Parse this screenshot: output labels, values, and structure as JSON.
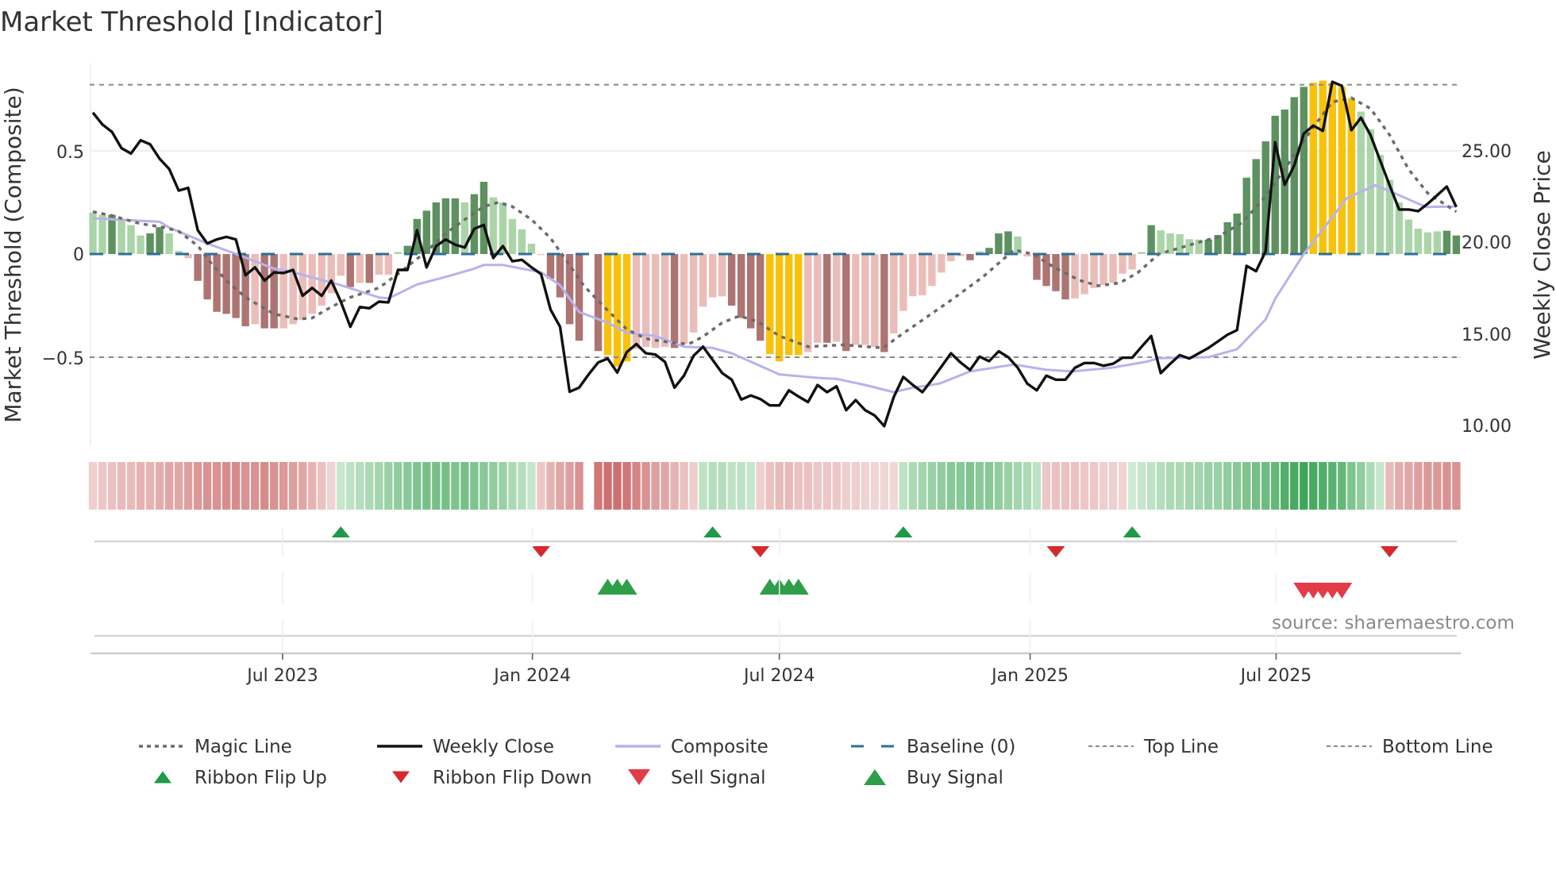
{
  "title": "Market Threshold [Indicator]",
  "source": "source: sharemaestro.com",
  "colors": {
    "G": "#5e9160",
    "g": "#abd5a8",
    "R": "#ad7472",
    "r": "#ebbdb8",
    "Y": "#f9c20a",
    "close": "#111111",
    "composite": "#b9b2ea",
    "magic": "#6b6b6b",
    "baseline": "#2e6e96",
    "threshold": "#8a8a8a",
    "flip_up": "#1f9a47",
    "flip_down": "#d62a2a",
    "buy": "#2e9e48",
    "sell": "#e23c48",
    "ribbon_up": "#2e9e4a",
    "ribbon_down": "#c85c5c"
  },
  "chart_data": {
    "type": "bar+line",
    "title": "Market Threshold [Indicator]",
    "ylabel_left": "Market Threshold (Composite)",
    "ylabel_right": "Weekly Close Price",
    "ylim_left": [
      -0.9,
      0.95
    ],
    "ylim_right": [
      8,
      31
    ],
    "y_ticks_left": [
      {
        "value": 0.5,
        "label": "0.5"
      },
      {
        "value": 0,
        "label": "0"
      },
      {
        "value": -0.5,
        "label": "−0.5"
      }
    ],
    "y_ticks_right": [
      {
        "value": 25,
        "label": "25.00"
      },
      {
        "value": 20,
        "label": "20.00"
      },
      {
        "value": 15,
        "label": "15.00"
      },
      {
        "value": 10,
        "label": "10.00"
      }
    ],
    "x_unit": "week index",
    "x_ticks": [
      {
        "week": 19.9,
        "label": "Jul 2023"
      },
      {
        "week": 46.1,
        "label": "Jan 2024"
      },
      {
        "week": 72.0,
        "label": "Jul 2024"
      },
      {
        "week": 98.3,
        "label": "Jan 2025"
      },
      {
        "week": 124.1,
        "label": "Jul 2025"
      }
    ],
    "top_line": 0.82,
    "bottom_line": -0.5,
    "baseline": 0,
    "histogram": [
      0.2,
      0.19,
      0.19,
      0.17,
      0.14,
      0.09,
      0.1,
      0.13,
      0.1,
      0.015,
      -0.02,
      -0.13,
      -0.22,
      -0.28,
      -0.29,
      -0.31,
      -0.35,
      -0.34,
      -0.36,
      -0.36,
      -0.36,
      -0.34,
      -0.32,
      -0.29,
      -0.25,
      -0.19,
      -0.105,
      -0.16,
      -0.14,
      -0.14,
      -0.1,
      -0.1,
      0.01,
      0.04,
      0.17,
      0.21,
      0.25,
      0.27,
      0.27,
      0.25,
      0.29,
      0.35,
      0.275,
      0.25,
      0.17,
      0.12,
      0.05,
      -0.005,
      -0.12,
      -0.21,
      -0.34,
      -0.42,
      null,
      -0.47,
      -0.49,
      -0.545,
      -0.52,
      -0.46,
      -0.45,
      -0.455,
      -0.45,
      -0.455,
      -0.435,
      -0.38,
      -0.255,
      -0.21,
      -0.205,
      -0.25,
      -0.31,
      -0.36,
      -0.42,
      -0.485,
      -0.52,
      -0.49,
      -0.49,
      -0.475,
      -0.43,
      -0.43,
      -0.425,
      -0.47,
      -0.44,
      -0.44,
      -0.45,
      -0.475,
      -0.385,
      -0.275,
      -0.205,
      -0.2,
      -0.155,
      -0.09,
      -0.035,
      -0.01,
      -0.03,
      0.013,
      0.03,
      0.1,
      0.11,
      0.085,
      -0.012,
      -0.125,
      -0.155,
      -0.18,
      -0.22,
      -0.215,
      -0.195,
      -0.165,
      -0.15,
      -0.14,
      -0.095,
      -0.075,
      0.01,
      0.14,
      0.115,
      0.1,
      0.096,
      0.072,
      0.07,
      0.07,
      0.092,
      0.154,
      0.196,
      0.37,
      0.46,
      0.546,
      0.67,
      0.7,
      0.76,
      0.81,
      0.83,
      0.84,
      0.83,
      0.81,
      0.755,
      0.69,
      0.605,
      0.48,
      0.36,
      0.25,
      0.167,
      0.123,
      0.105,
      0.11,
      0.113,
      0.09
    ],
    "histogram_states": "ggGgggGGggrRRRRRRrRRrrrrrrrRrRrrgGGGGGGgGGgggggrRRRR-RYYYrrrrRrrrrrRRRRYYYYrrRrRrrrRrrrrrrrrRgGGGgrRRRRrrrrrrrgGgggggGGGGGGGGGGGYYYYYgggggggggGGg",
    "weekly_close": [
      27.1,
      26.45,
      26.05,
      25.16,
      24.87,
      25.59,
      25.37,
      24.58,
      24.03,
      22.85,
      23.0,
      20.69,
      19.97,
      20.19,
      20.33,
      20.19,
      18.24,
      18.67,
      17.95,
      18.39,
      18.36,
      18.53,
      17.12,
      17.55,
      17.12,
      17.95,
      16.8,
      15.43,
      16.51,
      16.44,
      16.8,
      16.76,
      18.53,
      18.53,
      20.69,
      18.67,
      19.83,
      20.19,
      19.9,
      19.75,
      20.77,
      20.98,
      19.18,
      19.83,
      19.0,
      19.08,
      18.67,
      18.31,
      16.37,
      15.43,
      11.9,
      12.12,
      12.84,
      13.49,
      13.7,
      12.94,
      14.06,
      14.49,
      13.99,
      13.92,
      13.52,
      12.12,
      12.77,
      13.85,
      14.35,
      13.63,
      12.91,
      12.55,
      11.47,
      11.69,
      11.5,
      11.15,
      11.15,
      11.97,
      11.64,
      11.33,
      12.26,
      11.87,
      12.19,
      10.89,
      11.44,
      10.89,
      10.6,
      10.02,
      11.61,
      12.7,
      12.26,
      11.87,
      12.55,
      13.27,
      13.99,
      13.49,
      13.08,
      13.81,
      13.56,
      14.1,
      13.78,
      13.2,
      12.34,
      11.97,
      12.77,
      12.55,
      12.55,
      13.2,
      13.46,
      13.46,
      13.31,
      13.42,
      13.75,
      13.75,
      14.35,
      14.93,
      12.91,
      13.42,
      13.89,
      13.7,
      13.99,
      14.28,
      14.64,
      15.0,
      15.25,
      18.75,
      18.46,
      19.54,
      25.48,
      23.17,
      24.22,
      25.95,
      26.39,
      26.1,
      28.77,
      28.55,
      26.14,
      26.82,
      25.88,
      24.51,
      23.14,
      21.82,
      21.82,
      21.73,
      22.13,
      22.6,
      23.07,
      21.96
    ],
    "composite": [
      [
        0,
        21.34
      ],
      [
        7,
        21.15
      ],
      [
        8,
        20.84
      ],
      [
        12,
        19.97
      ],
      [
        15,
        19.4
      ],
      [
        19,
        18.6
      ],
      [
        21,
        18.4
      ],
      [
        26,
        17.7
      ],
      [
        30,
        17.03
      ],
      [
        31,
        16.98
      ],
      [
        34,
        17.74
      ],
      [
        37,
        18.15
      ],
      [
        40,
        18.6
      ],
      [
        41,
        18.8
      ],
      [
        43,
        18.8
      ],
      [
        47,
        18.4
      ],
      [
        49,
        17.7
      ],
      [
        51,
        16.24
      ],
      [
        54,
        15.66
      ],
      [
        56,
        15.1
      ],
      [
        59,
        14.93
      ],
      [
        62,
        14.35
      ],
      [
        65,
        14.28
      ],
      [
        67,
        13.99
      ],
      [
        72,
        12.84
      ],
      [
        76,
        12.65
      ],
      [
        78,
        12.6
      ],
      [
        81,
        12.26
      ],
      [
        84,
        11.87
      ],
      [
        86,
        12.12
      ],
      [
        88.8,
        12.34
      ],
      [
        92,
        13.0
      ],
      [
        96.6,
        13.38
      ],
      [
        99.9,
        13.1
      ],
      [
        102.7,
        13.0
      ],
      [
        106.8,
        13.2
      ],
      [
        110.4,
        13.52
      ],
      [
        111.8,
        13.72
      ],
      [
        117,
        13.78
      ],
      [
        120,
        14.21
      ],
      [
        123,
        15.83
      ],
      [
        124,
        16.95
      ],
      [
        127,
        19.4
      ],
      [
        129.8,
        21.28
      ],
      [
        131.5,
        22.43
      ],
      [
        134.5,
        23.14
      ],
      [
        136.5,
        22.71
      ],
      [
        139.8,
        21.96
      ],
      [
        143,
        21.99
      ]
    ],
    "magic_line": [
      [
        0,
        0.205
      ],
      [
        2,
        0.186
      ],
      [
        5,
        0.147
      ],
      [
        7.6,
        0.128
      ],
      [
        9,
        0.11
      ],
      [
        11,
        0.04
      ],
      [
        12.5,
        -0.05
      ],
      [
        14,
        -0.128
      ],
      [
        16,
        -0.21
      ],
      [
        19,
        -0.29
      ],
      [
        21.5,
        -0.315
      ],
      [
        23,
        -0.31
      ],
      [
        25,
        -0.256
      ],
      [
        27,
        -0.21
      ],
      [
        30,
        -0.164
      ],
      [
        32,
        -0.096
      ],
      [
        35,
        0.013
      ],
      [
        37,
        0.1
      ],
      [
        39.4,
        0.18
      ],
      [
        41,
        0.23
      ],
      [
        42.5,
        0.25
      ],
      [
        44,
        0.23
      ],
      [
        46,
        0.167
      ],
      [
        48,
        0.077
      ],
      [
        49.8,
        -0.04
      ],
      [
        51.5,
        -0.154
      ],
      [
        53.5,
        -0.25
      ],
      [
        56,
        -0.365
      ],
      [
        58,
        -0.41
      ],
      [
        60.8,
        -0.43
      ],
      [
        62.5,
        -0.436
      ],
      [
        64,
        -0.4
      ],
      [
        66,
        -0.333
      ],
      [
        67.8,
        -0.3
      ],
      [
        69.7,
        -0.327
      ],
      [
        72,
        -0.397
      ],
      [
        75,
        -0.449
      ],
      [
        78.7,
        -0.44
      ],
      [
        82.9,
        -0.455
      ],
      [
        84.5,
        -0.4
      ],
      [
        87,
        -0.32
      ],
      [
        90,
        -0.224
      ],
      [
        93.4,
        -0.109
      ],
      [
        96.6,
        0.02
      ],
      [
        98.6,
        0.0
      ],
      [
        100.8,
        -0.064
      ],
      [
        103.5,
        -0.128
      ],
      [
        105.5,
        -0.154
      ],
      [
        107.7,
        -0.14
      ],
      [
        109.6,
        -0.09
      ],
      [
        111.8,
        0.0
      ],
      [
        115.5,
        0.05
      ],
      [
        118,
        0.083
      ],
      [
        120.6,
        0.154
      ],
      [
        123,
        0.28
      ],
      [
        125.7,
        0.46
      ],
      [
        128,
        0.615
      ],
      [
        130,
        0.737
      ],
      [
        132,
        0.756
      ],
      [
        134,
        0.705
      ],
      [
        136,
        0.577
      ],
      [
        138,
        0.41
      ],
      [
        140,
        0.295
      ],
      [
        143,
        0.205
      ]
    ],
    "ribbon": [
      -0.15,
      -0.2,
      -0.25,
      -0.3,
      -0.3,
      -0.35,
      -0.35,
      -0.4,
      -0.45,
      -0.45,
      -0.5,
      -0.55,
      -0.6,
      -0.6,
      -0.65,
      -0.65,
      -0.6,
      -0.6,
      -0.65,
      -0.6,
      -0.55,
      -0.5,
      -0.45,
      -0.35,
      -0.25,
      -0.12,
      0.15,
      0.2,
      0.25,
      0.3,
      0.35,
      0.4,
      0.45,
      0.5,
      0.55,
      0.6,
      0.6,
      0.6,
      0.55,
      0.6,
      0.55,
      0.5,
      0.45,
      0.4,
      0.3,
      0.25,
      0.15,
      -0.2,
      -0.35,
      -0.45,
      -0.5,
      -0.6,
      null,
      -0.8,
      -0.85,
      -0.85,
      -0.8,
      -0.7,
      -0.6,
      -0.5,
      -0.45,
      -0.35,
      -0.25,
      -0.15,
      0.2,
      0.25,
      0.25,
      0.2,
      0.2,
      0.15,
      -0.15,
      -0.25,
      -0.3,
      -0.3,
      -0.25,
      -0.25,
      -0.2,
      -0.2,
      -0.2,
      -0.15,
      -0.15,
      -0.12,
      -0.1,
      -0.1,
      -0.08,
      0.2,
      0.3,
      0.35,
      0.4,
      0.45,
      0.5,
      0.5,
      0.55,
      0.5,
      0.5,
      0.45,
      0.4,
      0.35,
      0.3,
      0.2,
      -0.2,
      -0.25,
      -0.25,
      -0.25,
      -0.2,
      -0.2,
      -0.15,
      -0.15,
      -0.1,
      0.1,
      0.15,
      0.2,
      0.25,
      0.3,
      0.3,
      0.35,
      0.35,
      0.4,
      0.4,
      0.45,
      0.5,
      0.55,
      0.6,
      0.65,
      0.7,
      0.8,
      0.85,
      0.9,
      0.85,
      0.8,
      0.75,
      0.7,
      0.55,
      0.45,
      0.3,
      0.15,
      -0.3,
      -0.4,
      -0.45,
      -0.5,
      -0.55,
      -0.55,
      -0.6,
      -0.6
    ],
    "ribbon_flip_up": [
      26,
      65,
      85,
      109
    ],
    "ribbon_flip_down": [
      47,
      70,
      101,
      136
    ],
    "buy_signals": [
      54,
      55,
      56,
      71,
      72,
      73,
      74
    ],
    "sell_signals": [
      127,
      128,
      129,
      130,
      131
    ],
    "legend": {
      "placement": "bottom",
      "items": [
        {
          "key": "magic",
          "label": "Magic Line"
        },
        {
          "key": "close",
          "label": "Weekly Close"
        },
        {
          "key": "composite",
          "label": "Composite"
        },
        {
          "key": "baseline",
          "label": "Baseline (0)"
        },
        {
          "key": "top",
          "label": "Top Line"
        },
        {
          "key": "bottom",
          "label": "Bottom Line"
        },
        {
          "key": "flip_up",
          "label": "Ribbon Flip Up"
        },
        {
          "key": "flip_down",
          "label": "Ribbon Flip Down"
        },
        {
          "key": "sell",
          "label": "Sell Signal"
        },
        {
          "key": "buy",
          "label": "Buy Signal"
        }
      ]
    }
  }
}
